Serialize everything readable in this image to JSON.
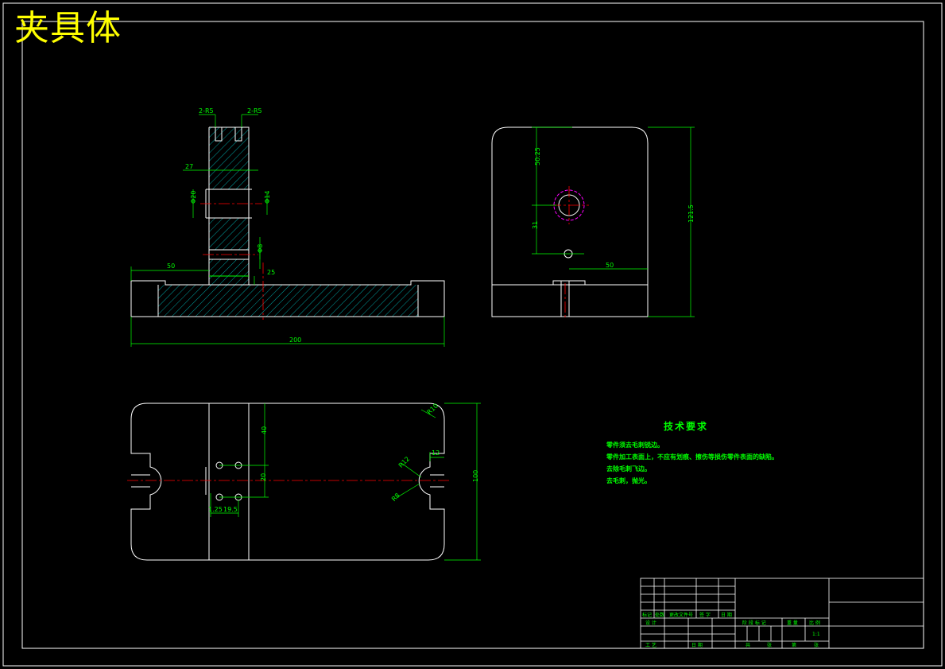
{
  "drawing": {
    "title": "夹具体",
    "colors": {
      "background": "#000000",
      "outline": "#ffffff",
      "dimension": "#00ff00",
      "centerline": "#ff0000",
      "hatch": "#00cccc",
      "title": "#ffff00",
      "hole_ring": "#ff00ff"
    },
    "front_view": {
      "dims": {
        "slot_left": "2-R5",
        "slot_right": "2-R5",
        "width_top": "27",
        "bore": "Φ20",
        "bore_right": "Φ14",
        "pin": "Φ8",
        "left_len": "50",
        "base_h": "25",
        "overall": "200"
      }
    },
    "side_view": {
      "dims": {
        "upper": "50.25",
        "lower": "31",
        "offset": "50",
        "height": "121.5"
      }
    },
    "top_view": {
      "dims": {
        "hole_v1": "40",
        "hole_v2": "20",
        "hole_h1": "1.25",
        "hole_h2": "19.5",
        "corner_r": "R10",
        "slot_w": "12",
        "slot_r": "R12",
        "slot_d": "R8",
        "height": "100"
      }
    },
    "tech_notes": {
      "title": "技术要求",
      "lines": [
        "零件须去毛刺锐边。",
        "零件加工表面上，不应有划痕、擦伤等损伤零件表面的缺陷。",
        "去除毛刺飞边。",
        "去毛刺，抛光。"
      ]
    },
    "title_block": {
      "row_labels": [
        "标记",
        "处数",
        "更改文件号",
        "签 字",
        "日 期"
      ],
      "design_label": "设 计",
      "review_label": "审 核",
      "process_label": "工 艺",
      "stage_labels": [
        "阶 段 标 记",
        "重 量",
        "比 例"
      ],
      "scale": "1:1",
      "sheet_labels": [
        "共",
        "张",
        "第",
        "张"
      ],
      "approve_label": "日 期"
    }
  }
}
